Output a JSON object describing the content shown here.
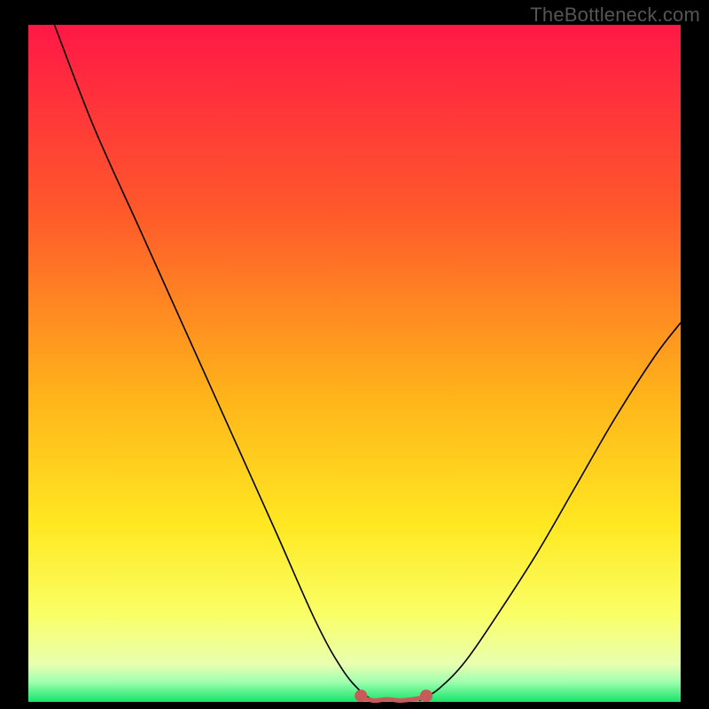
{
  "watermark": "TheBottleneck.com",
  "chart_data": {
    "type": "line",
    "title": "",
    "xlabel": "",
    "ylabel": "",
    "xlim": [
      0,
      100
    ],
    "ylim": [
      0,
      100
    ],
    "grid": false,
    "legend": false,
    "gradient_stops": [
      {
        "offset": 0.0,
        "color": "#ff1846"
      },
      {
        "offset": 0.28,
        "color": "#ff5a2a"
      },
      {
        "offset": 0.55,
        "color": "#ffb41a"
      },
      {
        "offset": 0.74,
        "color": "#ffe822"
      },
      {
        "offset": 0.87,
        "color": "#faff66"
      },
      {
        "offset": 0.945,
        "color": "#e8ffb0"
      },
      {
        "offset": 0.97,
        "color": "#a0ffb0"
      },
      {
        "offset": 1.0,
        "color": "#16e46a"
      }
    ],
    "series": [
      {
        "name": "left-curve",
        "stroke": "#000000",
        "x": [
          4,
          10,
          17,
          24,
          31,
          38,
          44,
          48,
          51,
          53
        ],
        "values": [
          100,
          85,
          70,
          55,
          40,
          25,
          12,
          5,
          1.5,
          0.2
        ]
      },
      {
        "name": "right-curve",
        "stroke": "#000000",
        "x": [
          60,
          63,
          67,
          72,
          78,
          84,
          90,
          96,
          100
        ],
        "values": [
          0.2,
          2,
          6,
          13,
          22,
          32,
          42,
          51,
          56
        ]
      },
      {
        "name": "bottom-marker-band",
        "stroke": "#c95a5a",
        "x": [
          51,
          53,
          55,
          57,
          59,
          61
        ],
        "values": [
          0.7,
          0.2,
          0.4,
          0.2,
          0.4,
          0.7
        ]
      }
    ],
    "markers": [
      {
        "x": 51,
        "y": 0.9,
        "r": 1.0,
        "color": "#c95a5a"
      },
      {
        "x": 61,
        "y": 0.9,
        "r": 1.0,
        "color": "#c95a5a"
      }
    ]
  }
}
